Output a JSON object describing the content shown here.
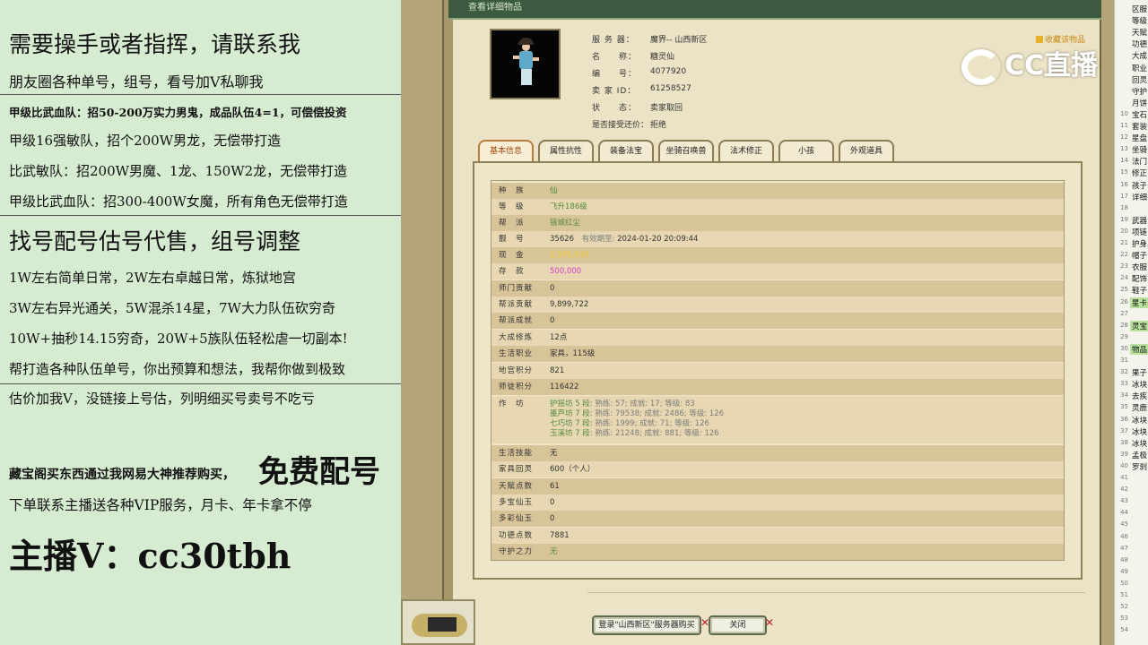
{
  "promo": {
    "lines": [
      "需要操手或者指挥，请联系我",
      "朋友圈各种单号，组号，看号加V私聊我",
      "甲级比武血队：招50-200万实力男鬼，成品队伍4=1，可偿偿投资",
      "甲级16强敏队，招个200W男龙，无偿带打造",
      "比武敏队：招200W男魔、1龙、150W2龙，无偿带打造",
      "甲级比武血队：招300-400W女魔，所有角色无偿带打造",
      "找号配号估号代售，组号调整",
      "1W左右简单日常，2W左右卓越日常，炼狱地宫",
      "3W左右异光通关，5W混杀14星，7W大力队伍砍穷奇",
      "10W+抽秒14.15穷奇，20W+5族队伍轻松虐一切副本!",
      "帮打造各种队伍单号，你出预算和想法，我帮你做到极致",
      "估价加我V，没链接上号估，列明细买号卖号不吃亏",
      "藏宝阁买东西通过我网易大神推荐购买，",
      "免费配号",
      "下单联系主播送各种VIP服务，月卡、年卡拿不停",
      "主播V：cc30tbh"
    ]
  },
  "window": {
    "title": "查看详细物品",
    "collect": "收藏该物品",
    "info": [
      {
        "label": "服 务 器：",
        "value": "魔界-- 山西新区"
      },
      {
        "label": "名　　称：",
        "value": "糖灵仙"
      },
      {
        "label": "编　　号：",
        "value": "4077920"
      },
      {
        "label": "卖 家 ID：",
        "value": "61258527"
      },
      {
        "label": "状　　态：",
        "value": "卖家取回"
      },
      {
        "label": "是否接受还价：",
        "value": "拒绝"
      }
    ],
    "tabs": [
      "基本信息",
      "属性抗性",
      "装备法宝",
      "坐骑召唤兽",
      "法术修正",
      "小孩",
      "外观道具"
    ],
    "rows": [
      {
        "k": "种　族",
        "v": "仙",
        "c": "green"
      },
      {
        "k": "等　级",
        "v": "飞升186级",
        "c": "green"
      },
      {
        "k": "帮　派",
        "v": "镜城红尘",
        "c": "green"
      },
      {
        "k": "靓　号",
        "v": "35626",
        "extra": "有效期至:",
        "extra2": "2024-01-20 20:09:44"
      },
      {
        "k": "现　金",
        "v": "1,555,540",
        "c": "yellow"
      },
      {
        "k": "存　款",
        "v": "500,000",
        "c": "magenta"
      },
      {
        "k": "师门贡献",
        "v": "0"
      },
      {
        "k": "帮派贡献",
        "v": "9,899,722"
      },
      {
        "k": "帮派成就",
        "v": "0"
      },
      {
        "k": "大成修炼",
        "v": "12点"
      },
      {
        "k": "生活职业",
        "v": "家具，115级"
      },
      {
        "k": "地宫积分",
        "v": "821"
      },
      {
        "k": "师徒积分",
        "v": "116422"
      },
      {
        "k": "作　坊",
        "sub": [
          {
            "a": "护摇坊 5 段:",
            "b": "熟练: 57; 成就: 17; 等级: 83"
          },
          {
            "a": "墨芦坊 7 段:",
            "b": "熟练: 79538; 成就: 2486; 等级: 126"
          },
          {
            "a": "七巧坊 7 段:",
            "b": "熟练: 1999; 成就: 71; 等级: 126"
          },
          {
            "a": "玉溪坊 7 段:",
            "b": "熟练: 21248; 成就: 881; 等级: 126"
          }
        ]
      },
      {
        "k": "生活技能",
        "v": "无"
      },
      {
        "k": "家具回灵",
        "v": "600（个人）"
      },
      {
        "k": "天赋点数",
        "v": "61"
      },
      {
        "k": "多宝仙玉",
        "v": "0"
      },
      {
        "k": "多彩仙玉",
        "v": "0"
      },
      {
        "k": "功德点数",
        "v": "7881"
      },
      {
        "k": "守护之力",
        "v": "无",
        "c": "green"
      }
    ],
    "buttons": {
      "login": "登录\"山西新区\"服务器购买",
      "close": "关闭"
    }
  },
  "overlay": {
    "logo": "CC直播"
  },
  "sidebar": {
    "items": [
      {
        "n": "",
        "t": "区服"
      },
      {
        "n": "",
        "t": "等级"
      },
      {
        "n": "",
        "t": "天赋"
      },
      {
        "n": "",
        "t": "功德"
      },
      {
        "n": "",
        "t": "大成"
      },
      {
        "n": "",
        "t": "职业"
      },
      {
        "n": "",
        "t": "回灵"
      },
      {
        "n": "",
        "t": "守护"
      },
      {
        "n": "",
        "t": "月饼"
      },
      {
        "n": "10",
        "t": "宝石"
      },
      {
        "n": "11",
        "t": "套装"
      },
      {
        "n": "12",
        "t": "星盘"
      },
      {
        "n": "13",
        "t": "坐骑"
      },
      {
        "n": "14",
        "t": "法门"
      },
      {
        "n": "15",
        "t": "修正"
      },
      {
        "n": "16",
        "t": "孩子"
      },
      {
        "n": "17",
        "t": "详细"
      },
      {
        "n": "18",
        "t": ""
      },
      {
        "n": "19",
        "t": "武器"
      },
      {
        "n": "20",
        "t": "项链"
      },
      {
        "n": "21",
        "t": "护身"
      },
      {
        "n": "22",
        "t": "帽子"
      },
      {
        "n": "23",
        "t": "衣服"
      },
      {
        "n": "24",
        "t": "配饰"
      },
      {
        "n": "25",
        "t": "鞋子"
      },
      {
        "n": "26",
        "t": "星卡"
      },
      {
        "n": "27",
        "t": ""
      },
      {
        "n": "28",
        "t": "灵宝"
      },
      {
        "n": "29",
        "t": ""
      },
      {
        "n": "30",
        "t": "物品"
      },
      {
        "n": "31",
        "t": ""
      },
      {
        "n": "32",
        "t": "果子"
      },
      {
        "n": "33",
        "t": "冰块"
      },
      {
        "n": "34",
        "t": "去疾"
      },
      {
        "n": "35",
        "t": "灵鹿"
      },
      {
        "n": "36",
        "t": "冰块"
      },
      {
        "n": "37",
        "t": "冰块"
      },
      {
        "n": "38",
        "t": "冰块"
      },
      {
        "n": "39",
        "t": "孟极"
      },
      {
        "n": "40",
        "t": "罗刹"
      },
      {
        "n": "41",
        "t": ""
      },
      {
        "n": "42",
        "t": ""
      },
      {
        "n": "43",
        "t": ""
      },
      {
        "n": "44",
        "t": ""
      },
      {
        "n": "45",
        "t": ""
      },
      {
        "n": "46",
        "t": ""
      },
      {
        "n": "47",
        "t": ""
      },
      {
        "n": "48",
        "t": ""
      },
      {
        "n": "49",
        "t": ""
      },
      {
        "n": "50",
        "t": ""
      },
      {
        "n": "51",
        "t": ""
      },
      {
        "n": "52",
        "t": ""
      },
      {
        "n": "53",
        "t": ""
      },
      {
        "n": "54",
        "t": ""
      }
    ]
  }
}
